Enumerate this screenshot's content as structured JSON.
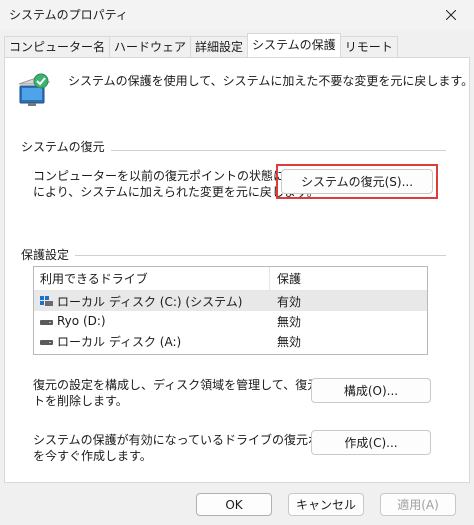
{
  "window": {
    "title": "システムのプロパティ"
  },
  "tabs": [
    {
      "label": "コンピューター名"
    },
    {
      "label": "ハードウェア"
    },
    {
      "label": "詳細設定"
    },
    {
      "label": "システムの保護"
    },
    {
      "label": "リモート"
    }
  ],
  "intro": {
    "text": "システムの保護を使用して、システムに加えた不要な変更を元に戻します。"
  },
  "restore": {
    "section_label": "システムの復元",
    "description_line1": "コンピューターを以前の復元ポイントの状態に戻すこと",
    "description_line2": "により、システムに加えられた変更を元に戻します。",
    "button_label": "システムの復元(S)..."
  },
  "protection": {
    "section_label": "保護設定",
    "columns": {
      "drive": "利用できるドライブ",
      "status": "保護"
    },
    "drives": [
      {
        "name": "ローカル ディスク (C:) (システム)",
        "status": "有効",
        "icon": "system-drive-icon"
      },
      {
        "name": "Ryo (D:)",
        "status": "無効",
        "icon": "drive-icon"
      },
      {
        "name": "ローカル ディスク (A:)",
        "status": "無効",
        "icon": "drive-icon"
      }
    ],
    "configure_line1": "復元の設定を構成し、ディスク領域を管理して、復元ポイン",
    "configure_line2": "トを削除します。",
    "configure_button": "構成(O)...",
    "create_line1": "システムの保護が有効になっているドライブの復元ポイント",
    "create_line2": "を今すぐ作成します。",
    "create_button": "作成(C)..."
  },
  "footer": {
    "ok": "OK",
    "cancel": "キャンセル",
    "apply": "適用(A)"
  },
  "colors": {
    "highlight": "#e03a3a",
    "window_bg": "#f0f0f0",
    "panel_bg": "#ffffff"
  }
}
